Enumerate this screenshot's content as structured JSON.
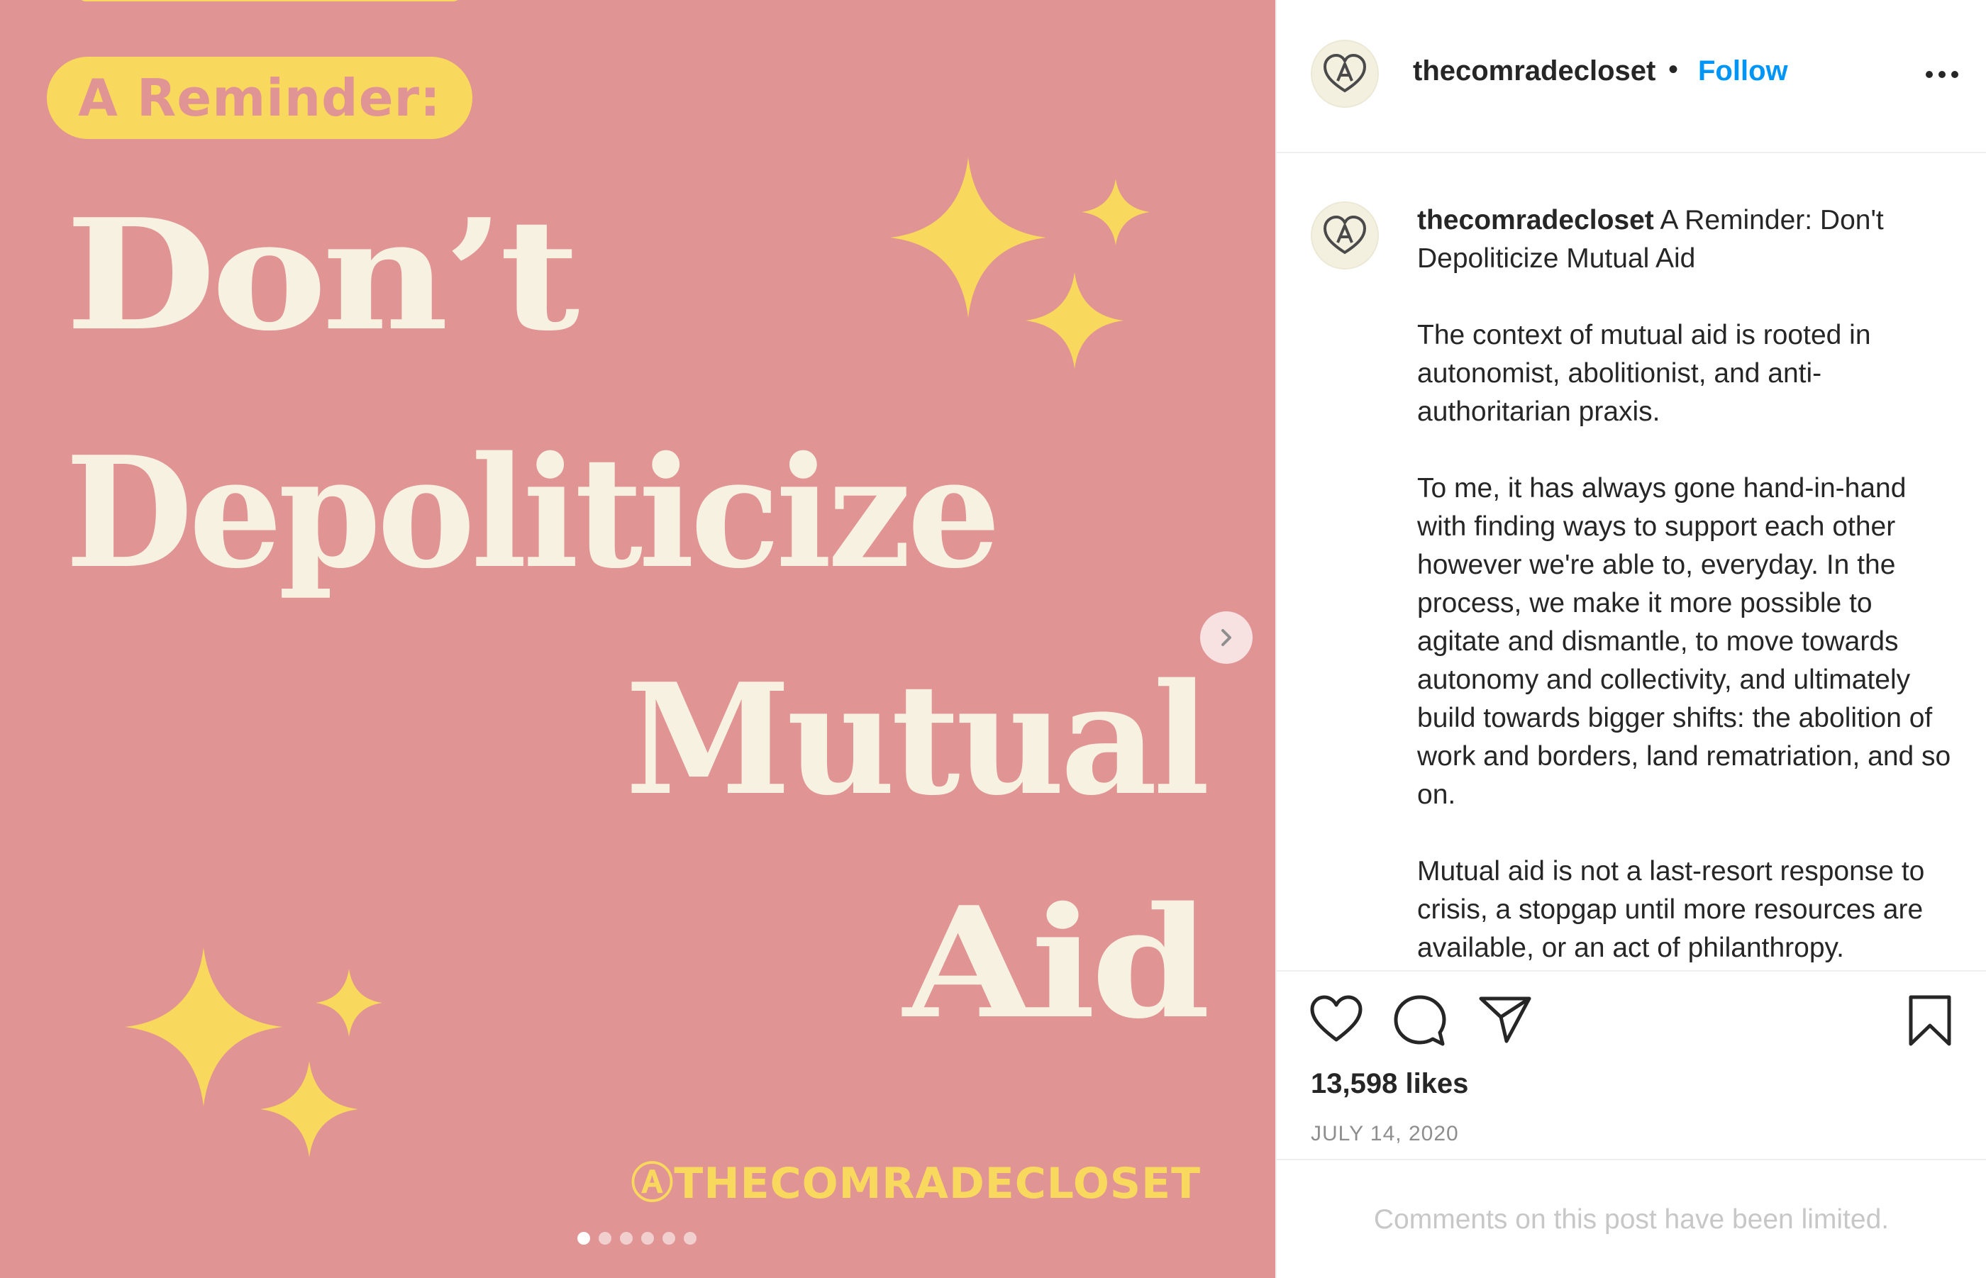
{
  "image": {
    "reminder_label": "A Reminder:",
    "headline": [
      "Don’t",
      "Depoliticize",
      "Mutual",
      "Aid"
    ],
    "handle": "ⒶTHECOMRADECLOSET",
    "carousel": {
      "slide_count": 6,
      "active_slide": 1
    },
    "colors": {
      "background": "#e09494",
      "accent": "#f9d85e",
      "text": "#f7f1e1"
    }
  },
  "header": {
    "username": "thecomradecloset",
    "separator": "•",
    "follow_label": "Follow",
    "more_icon": "more-options-icon"
  },
  "caption": {
    "username": "thecomradecloset",
    "title": "A Reminder: Don't Depoliticize Mutual Aid",
    "paragraphs": [
      "The context of mutual aid is rooted in autonomist, abolitionist, and anti-authoritarian praxis.",
      "To me, it has always gone hand-in-hand with finding ways to support each other however we're able to, everyday. In the process, we make it more possible to agitate and dismantle, to move towards autonomy and collectivity, and ultimately build towards bigger shifts: the abolition of work and borders, land rematriation, and so on.",
      "Mutual aid is not a last-resort response to crisis, a stopgap until more resources are available, or an act of philanthropy."
    ]
  },
  "actions": {
    "icons": [
      "heart-icon",
      "comment-icon",
      "share-icon",
      "bookmark-icon"
    ],
    "likes": "13,598 likes",
    "date": "JULY 14, 2020"
  },
  "comments": {
    "limited_notice": "Comments on this post have been limited."
  },
  "colors": {
    "link": "#0095f6",
    "text": "#262626",
    "muted": "#8e8e8e"
  }
}
